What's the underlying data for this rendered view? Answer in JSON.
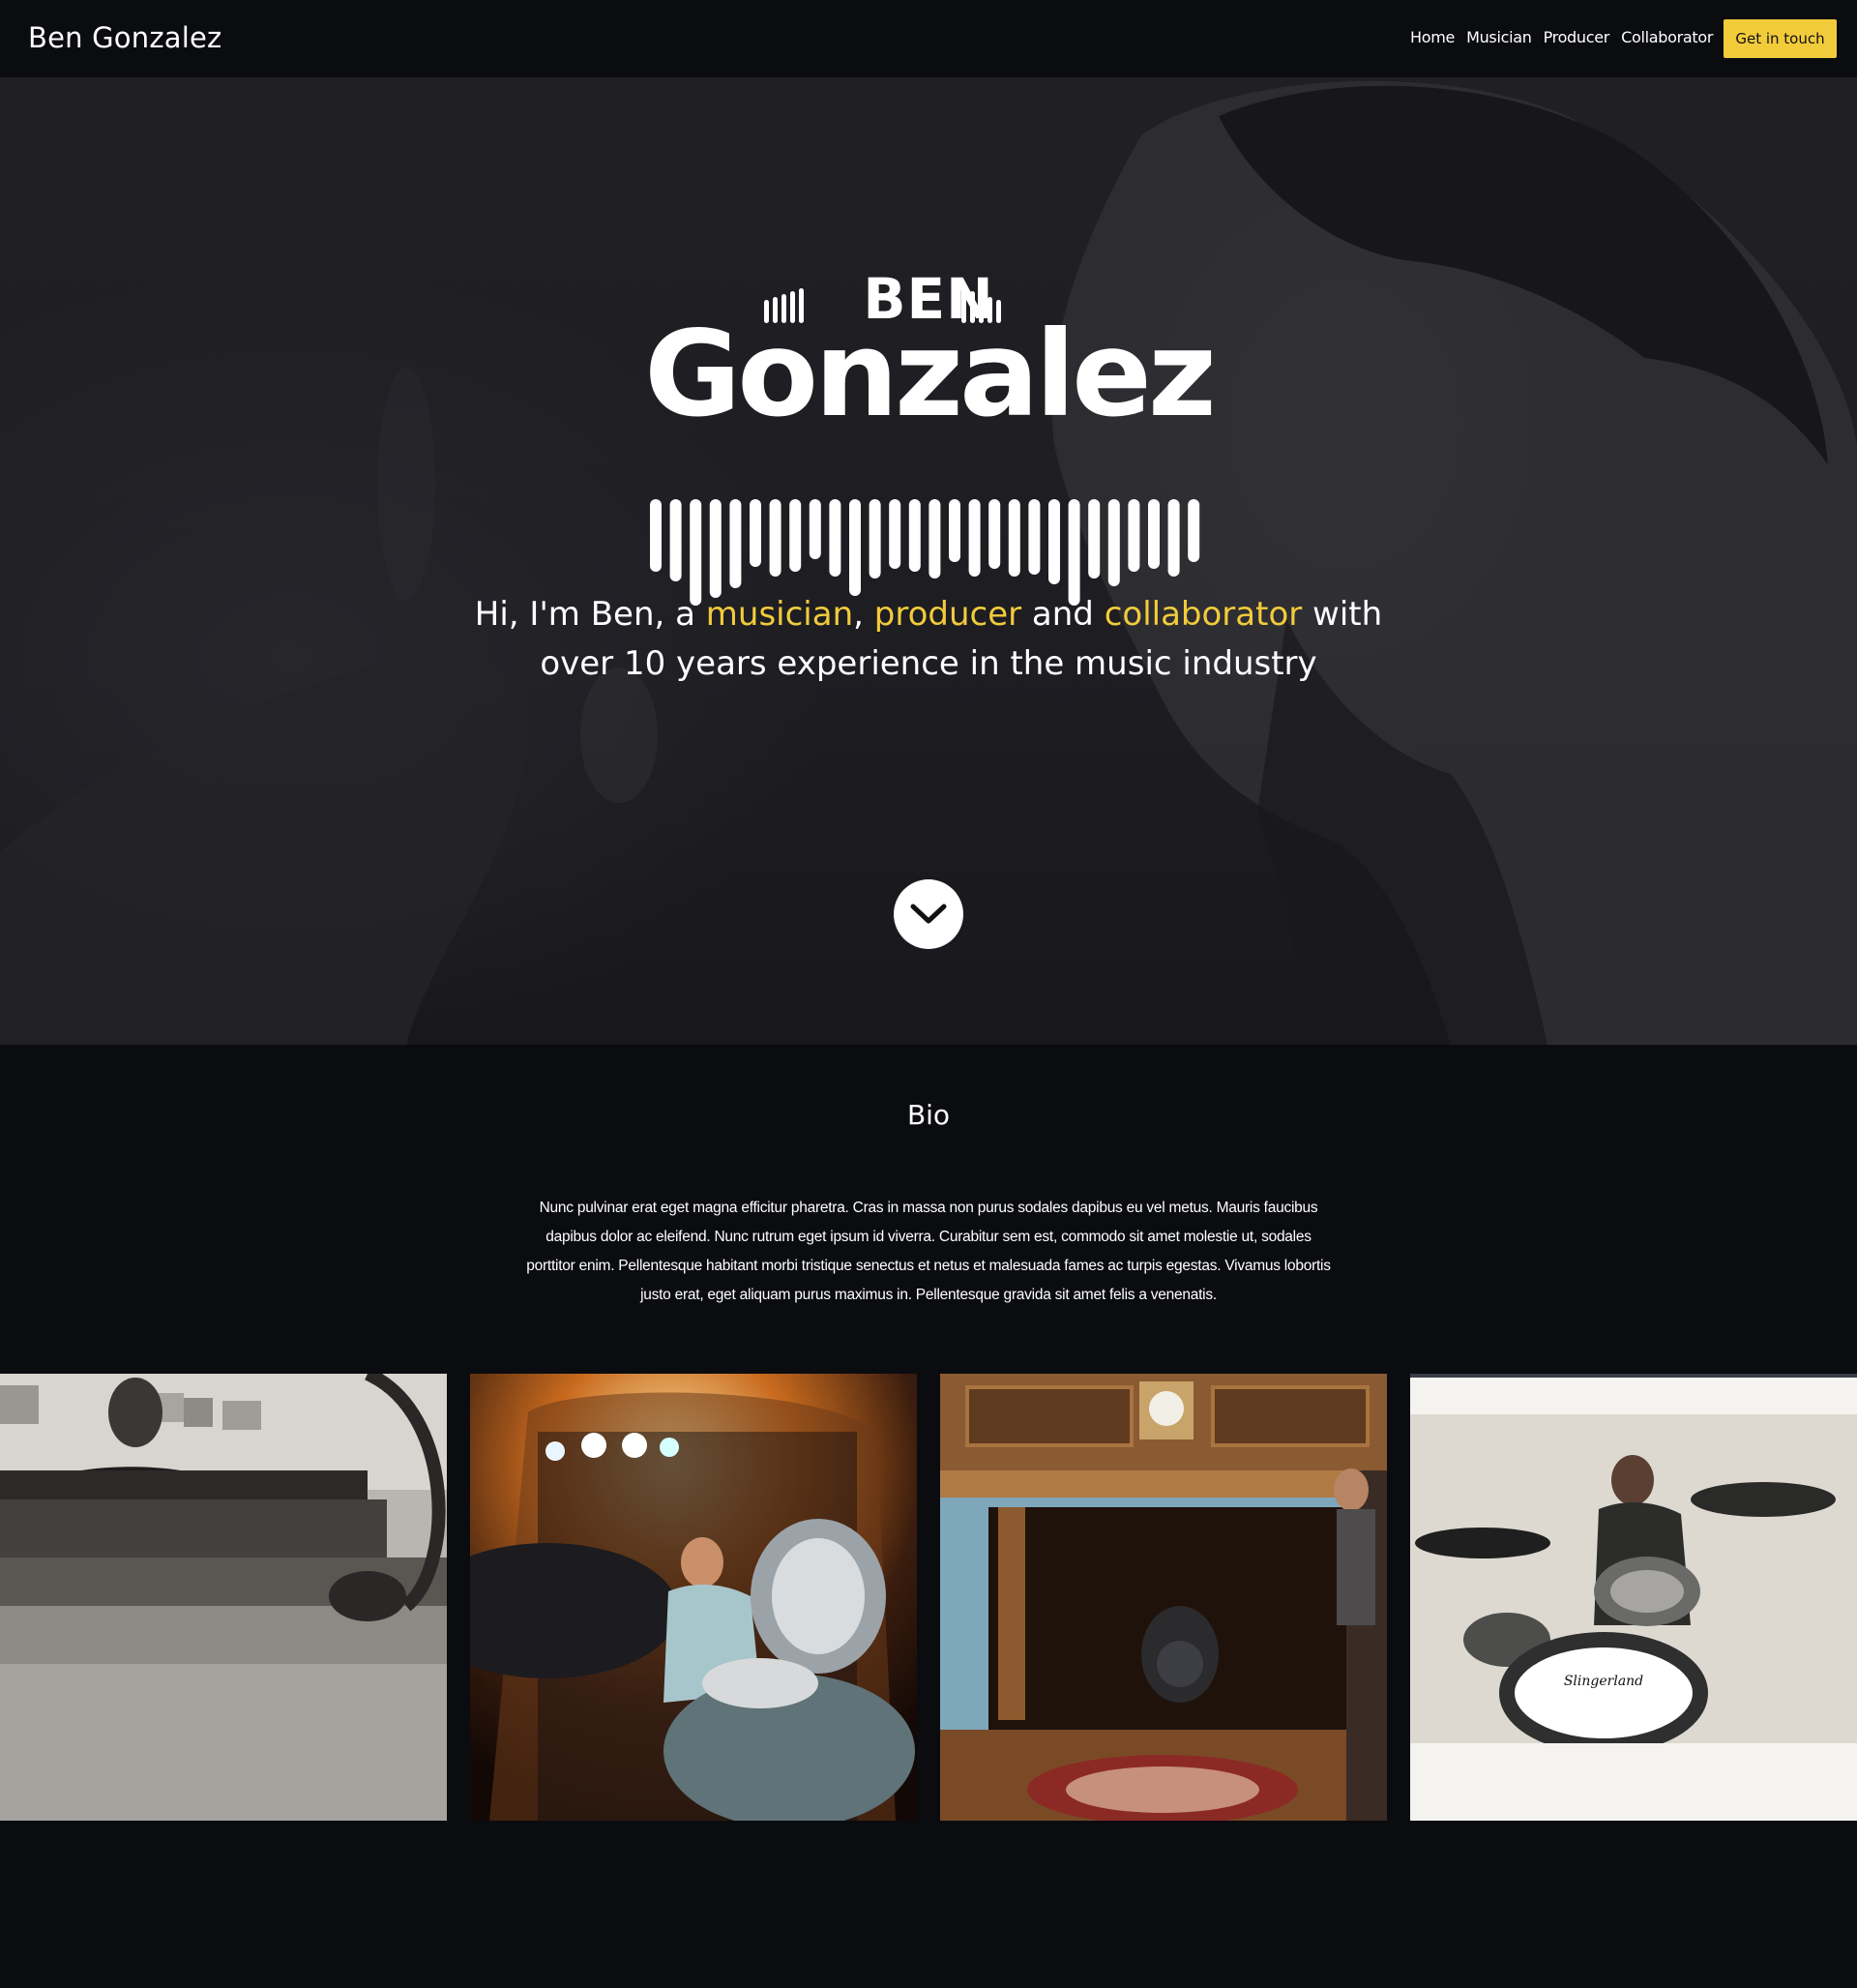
{
  "nav": {
    "brand": "Ben Gonzalez",
    "links": [
      "Home",
      "Musician",
      "Producer",
      "Collaborator"
    ],
    "cta_label": "Get in touch"
  },
  "hero": {
    "logo_top": "BEN",
    "logo_name": "Gonzalez",
    "tagline": {
      "intro": "Hi, I'm Ben, a ",
      "role1": "musician",
      "sep1": ", ",
      "role2": "producer",
      "sep2": " and ",
      "role3": "collaborator",
      "rest": " with over 10 years experience in the music industry"
    },
    "scroll_icon": "chevron-down-icon"
  },
  "bio": {
    "title": "Bio",
    "text": "Nunc pulvinar erat eget magna efficitur pharetra. Cras in massa non purus sodales dapibus eu vel metus. Mauris faucibus dapibus dolor ac eleifend. Nunc rutrum eget ipsum id viverra. Curabitur sem est, commodo sit amet molestie ut, sodales porttitor enim. Pellentesque habitant morbi tristique senectus et netus et malesuada fames ac turpis egestas. Vivamus lobortis justo erat, eget aliquam purus maximus in. Pellentesque gravida sit amet felis a venenatis."
  },
  "gallery": {
    "drum_brand": "Slingerland"
  },
  "colors": {
    "background": "#0b0c10",
    "accent": "#f2cb3b",
    "text": "#ffffff"
  }
}
